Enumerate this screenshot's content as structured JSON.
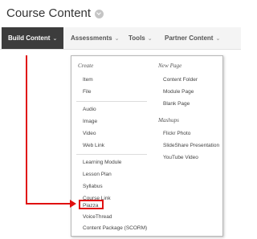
{
  "page": {
    "title": "Course Content",
    "title_icon": "check-circle-icon"
  },
  "menubar": {
    "items": [
      {
        "label": "Build Content"
      },
      {
        "label": "Assessments"
      },
      {
        "label": "Tools"
      },
      {
        "label": "Partner Content"
      }
    ],
    "chevron": "⌄"
  },
  "dropdown": {
    "left": {
      "create_header": "Create",
      "group1": [
        "Item",
        "File"
      ],
      "group2": [
        "Audio",
        "Image",
        "Video",
        "Web Link"
      ],
      "group3": [
        "Learning Module",
        "Lesson Plan",
        "Syllabus",
        "Course Link",
        "Piazza",
        "VoiceThread",
        "Content Package (SCORM)"
      ]
    },
    "right": {
      "new_page_header": "New Page",
      "new_page_items": [
        "Content Folder",
        "Module Page",
        "Blank Page"
      ],
      "mashups_header": "Mashups",
      "mashups_items": [
        "Flickr Photo",
        "SlideShare Presentation",
        "YouTube Video"
      ]
    }
  },
  "annotation": {
    "color": "#e01010"
  }
}
